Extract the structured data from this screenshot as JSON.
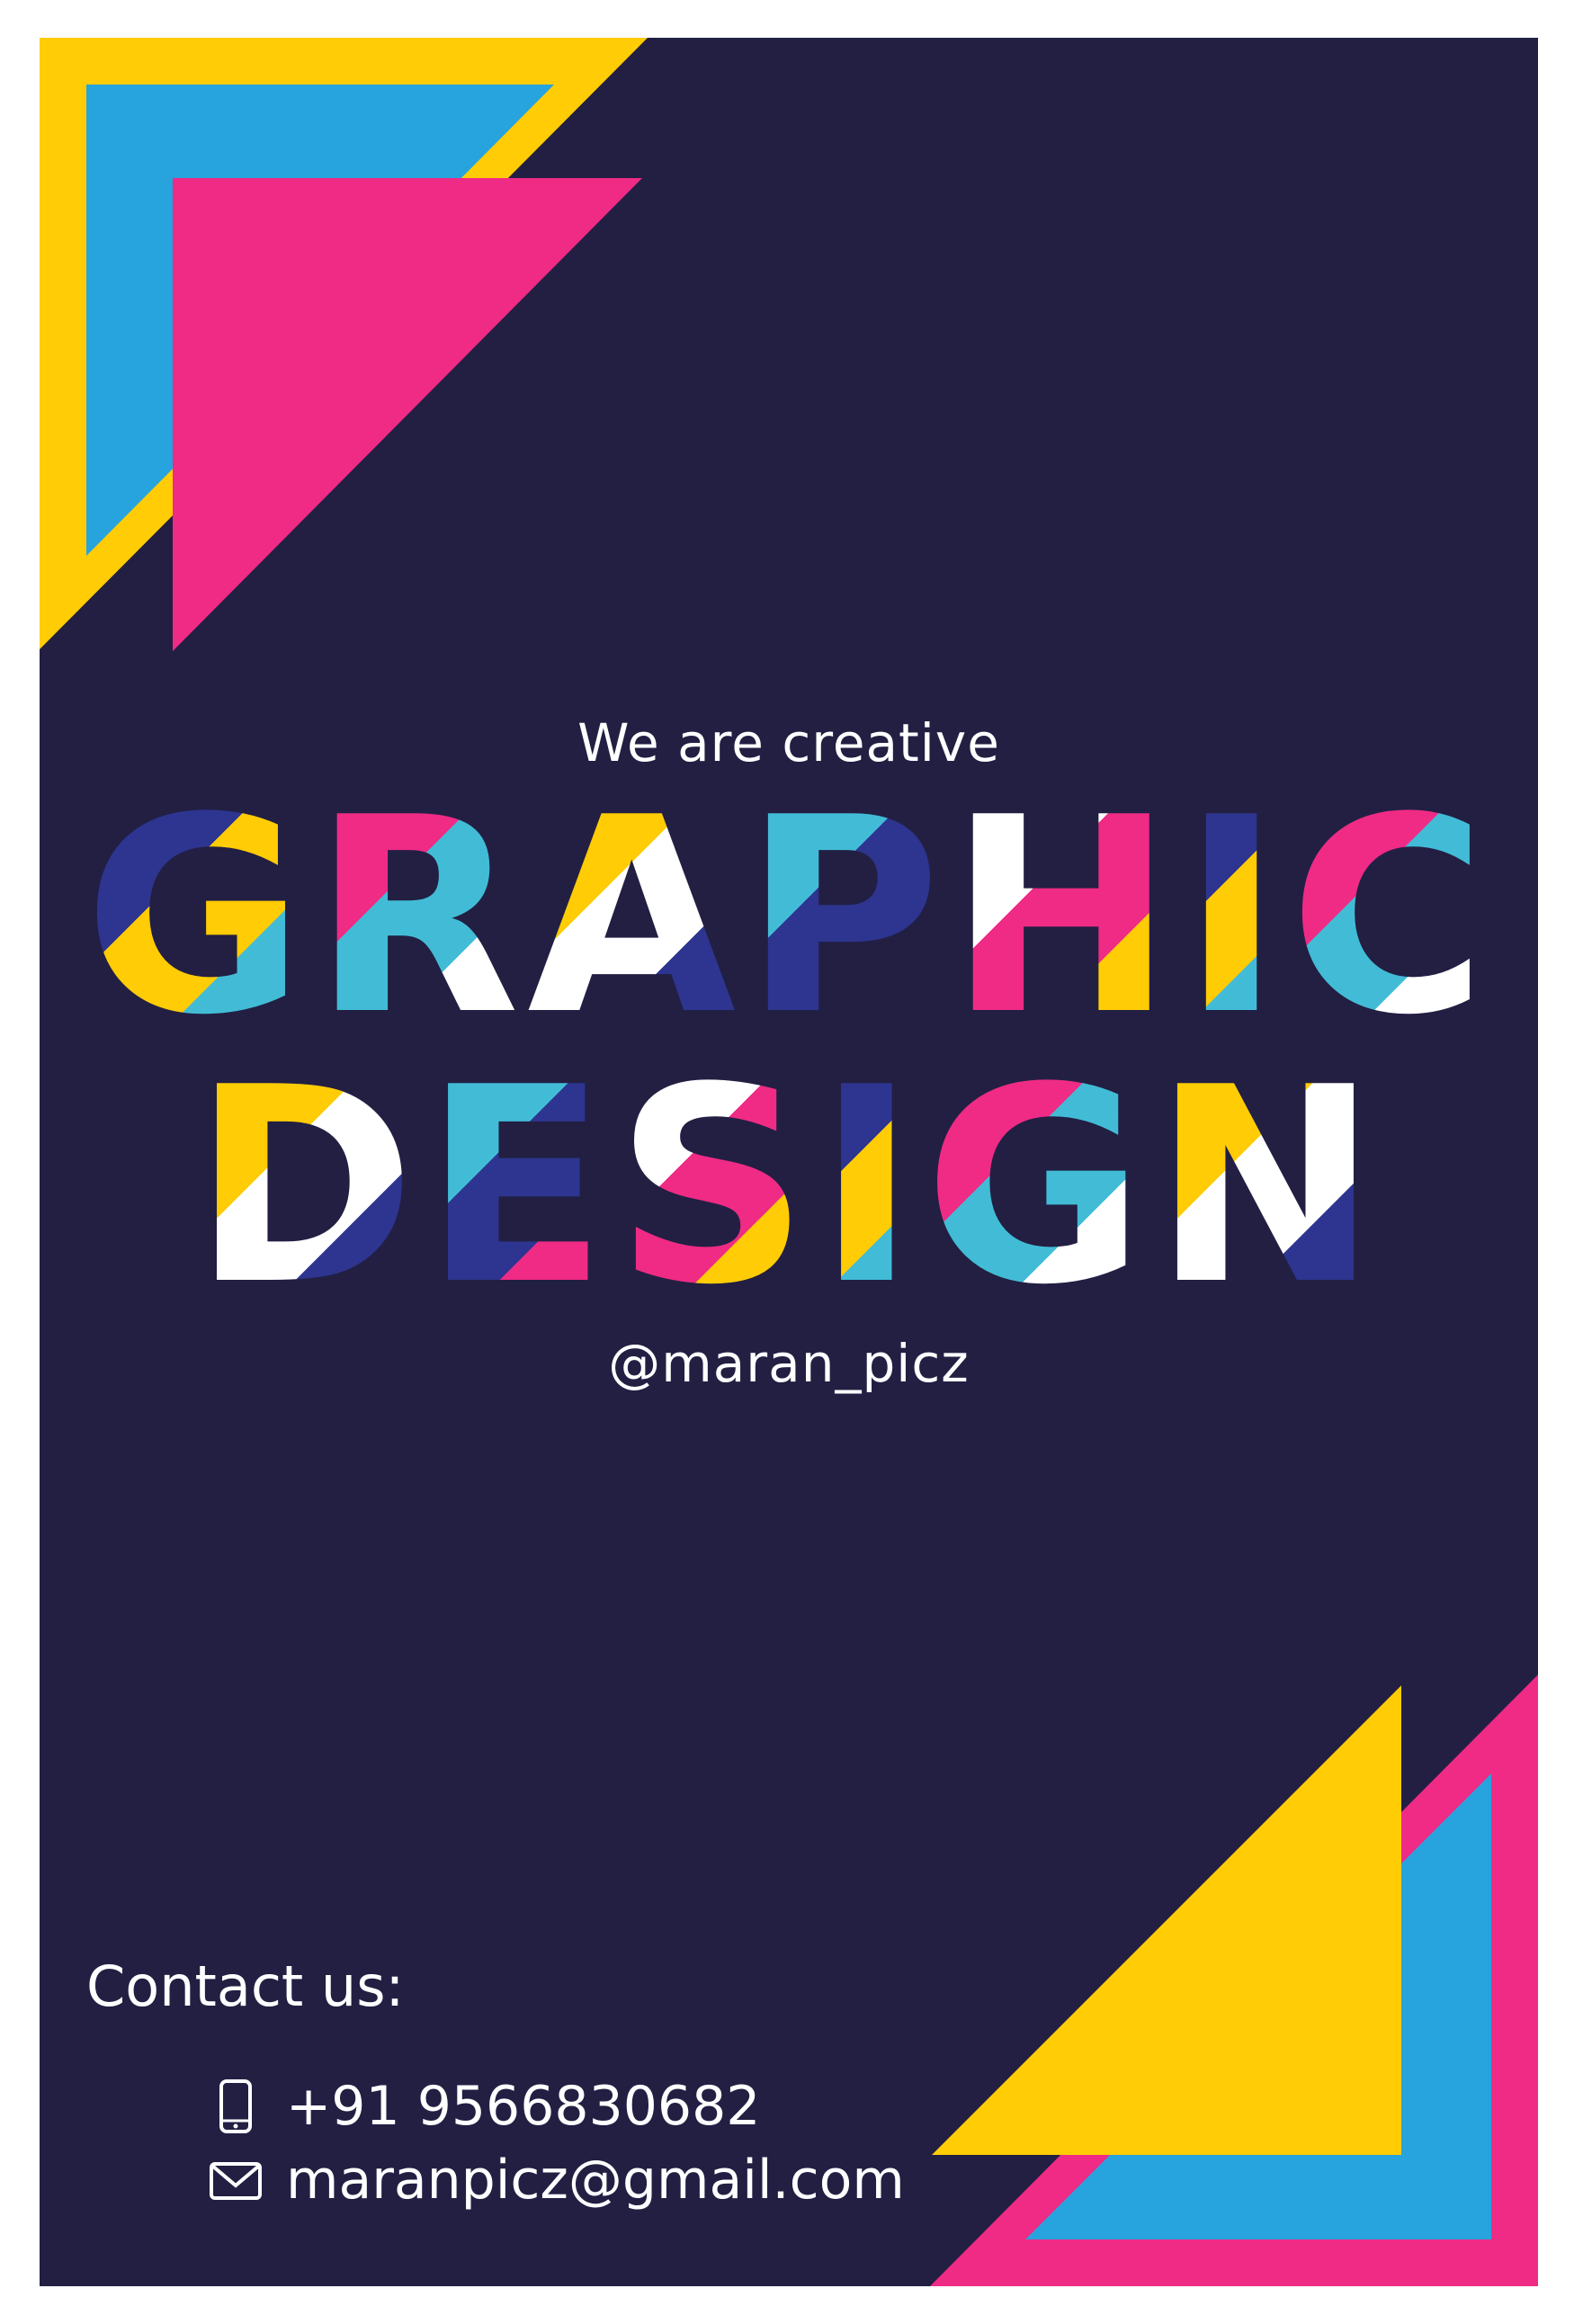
{
  "tagline": "We are creative",
  "headline": {
    "line1": "GRAPHIC",
    "line2": "DESIGN",
    "palette": [
      "#2d3590",
      "#ef2b85",
      "#ffcc05",
      "#42bcd6",
      "#ffffff"
    ]
  },
  "handle": "@maran_picz",
  "contact": {
    "title": "Contact us:",
    "phone": "+91 9566830682",
    "phone_icon": "phone-icon",
    "email": "maranpicz@gmail.com",
    "email_icon": "mail-icon"
  },
  "colors": {
    "background": "#221f43",
    "yellow": "#ffcc05",
    "blue": "#27a3dd",
    "pink": "#ef2b85",
    "text": "#ffffff"
  }
}
